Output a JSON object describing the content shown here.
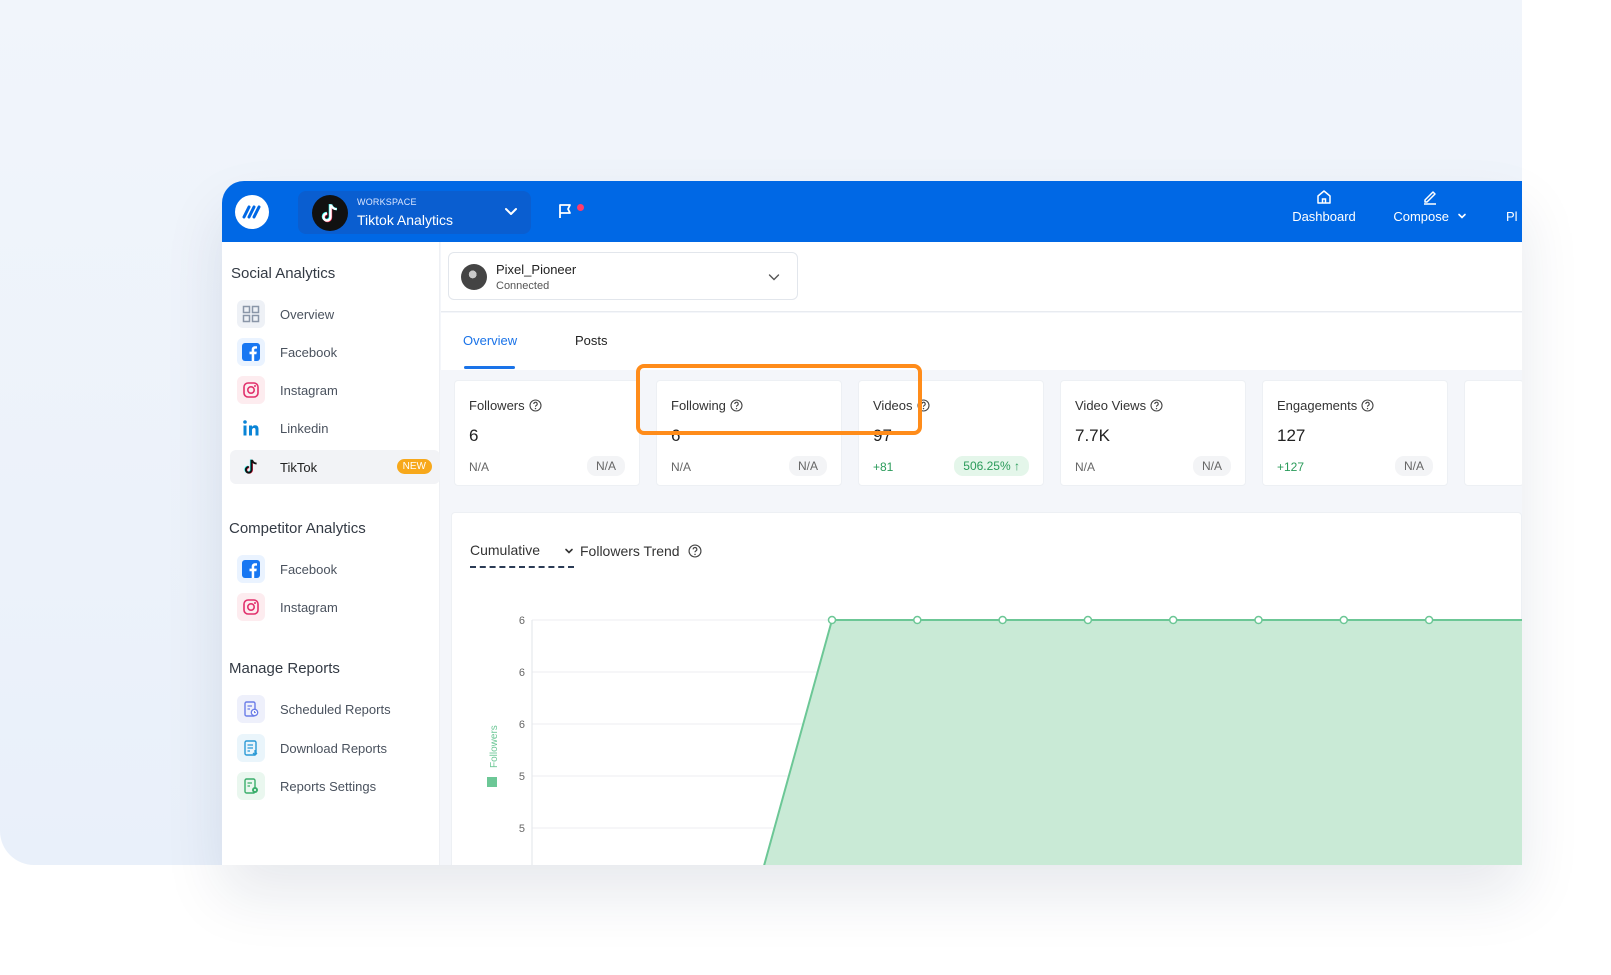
{
  "header": {
    "workspace_caption": "WORKSPACE",
    "workspace_name": "Tiktok Analytics",
    "nav": {
      "dashboard": "Dashboard",
      "compose": "Compose",
      "partial": "Pl"
    }
  },
  "sidebar": {
    "social_title": "Social Analytics",
    "social_items": [
      {
        "label": "Overview",
        "icon": "grid-icon"
      },
      {
        "label": "Facebook",
        "icon": "facebook-icon"
      },
      {
        "label": "Instagram",
        "icon": "instagram-icon"
      },
      {
        "label": "Linkedin",
        "icon": "linkedin-icon"
      },
      {
        "label": "TikTok",
        "icon": "tiktok-icon",
        "badge": "NEW",
        "active": true
      }
    ],
    "competitor_title": "Competitor Analytics",
    "competitor_items": [
      {
        "label": "Facebook",
        "icon": "facebook-icon"
      },
      {
        "label": "Instagram",
        "icon": "instagram-icon"
      }
    ],
    "reports_title": "Manage Reports",
    "report_items": [
      {
        "label": "Scheduled Reports",
        "icon": "scheduled-report-icon"
      },
      {
        "label": "Download Reports",
        "icon": "download-report-icon"
      },
      {
        "label": "Reports Settings",
        "icon": "report-settings-icon"
      }
    ]
  },
  "account": {
    "name": "Pixel_Pioneer",
    "status": "Connected"
  },
  "tabs": [
    {
      "label": "Overview",
      "active": true
    },
    {
      "label": "Posts",
      "active": false
    }
  ],
  "stats": [
    {
      "title": "Followers",
      "value": "6",
      "delta": "N/A",
      "change": "N/A"
    },
    {
      "title": "Following",
      "value": "6",
      "delta": "N/A",
      "change": "N/A"
    },
    {
      "title": "Videos",
      "value": "97",
      "delta": "+81",
      "change": "506.25% ↑"
    },
    {
      "title": "Video Views",
      "value": "7.7K",
      "delta": "N/A",
      "change": "N/A"
    },
    {
      "title": "Engagements",
      "value": "127",
      "delta": "+127",
      "change": "N/A"
    }
  ],
  "chart": {
    "mode": "Cumulative",
    "title": "Followers Trend",
    "ylabel": "Followers",
    "colors": {
      "fill": "#c9ead6",
      "stroke": "#6cc796",
      "accent": "#0068e5",
      "highlight": "#ff8c1a"
    }
  },
  "chart_data": {
    "type": "area",
    "title": "Followers Trend",
    "ylabel": "Followers",
    "y_tick_labels": [
      "6",
      "6",
      "6",
      "5",
      "5"
    ],
    "ylim": [
      5,
      6
    ],
    "series": [
      {
        "name": "Followers",
        "values": [
          5,
          6,
          6,
          6,
          6,
          6,
          6,
          6,
          6
        ]
      }
    ]
  }
}
